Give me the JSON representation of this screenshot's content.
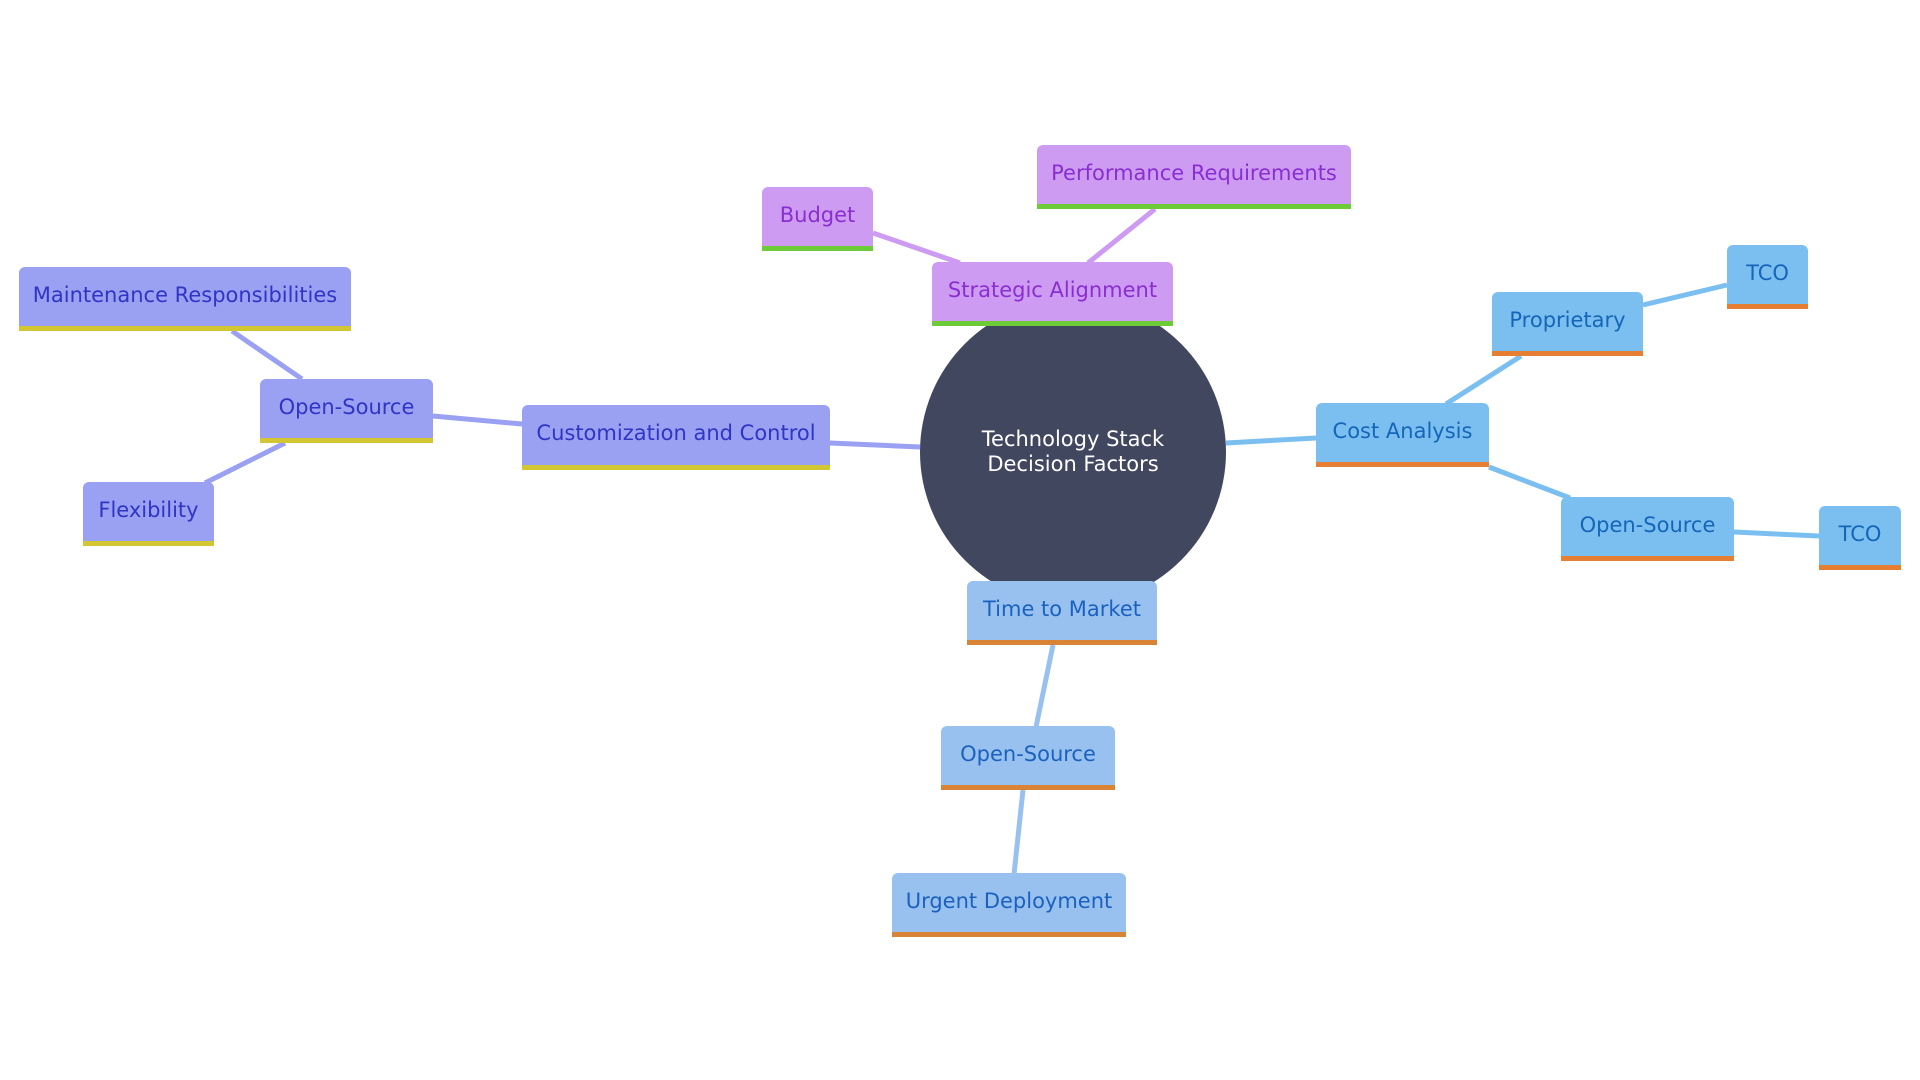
{
  "root": {
    "label": "Technology Stack Decision Factors"
  },
  "branches": {
    "strategic": {
      "label": "Strategic Alignment",
      "color": "#cd9cf2",
      "children": {
        "budget": "Budget",
        "performance": "Performance Requirements"
      }
    },
    "customization": {
      "label": "Customization and Control",
      "color": "#9aa0f2",
      "open_source": {
        "label": "Open-Source",
        "children": {
          "maintenance": "Maintenance Responsibilities",
          "flexibility": "Flexibility"
        }
      }
    },
    "cost": {
      "label": "Cost Analysis",
      "color": "#7bbff0",
      "proprietary": {
        "label": "Proprietary",
        "tco": "TCO"
      },
      "open_source": {
        "label": "Open-Source",
        "tco": "TCO"
      }
    },
    "time": {
      "label": "Time to Market",
      "color": "#98c1f0",
      "open_source": {
        "label": "Open-Source",
        "urgent": "Urgent Deployment"
      }
    }
  }
}
